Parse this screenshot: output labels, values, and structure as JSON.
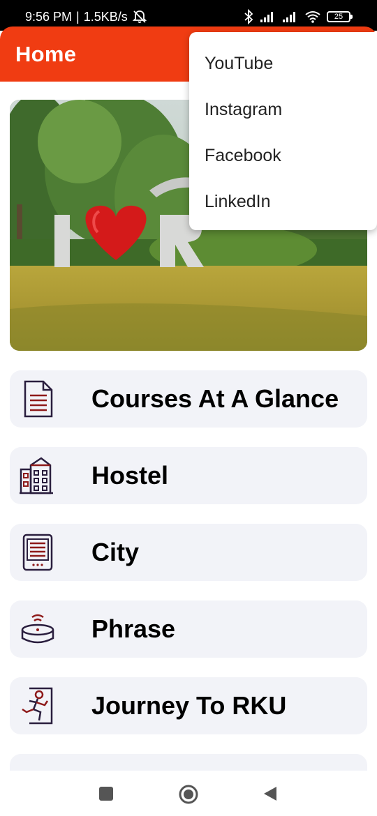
{
  "status_bar": {
    "time": "9:56 PM",
    "separator": "|",
    "speed": "1.5KB/s",
    "battery": "25",
    "icons": [
      "alarm-off-icon",
      "bluetooth-icon",
      "signal-icon",
      "signal-icon",
      "wifi-icon",
      "battery-icon"
    ]
  },
  "app_bar": {
    "title": "Home",
    "color": "#f03c12"
  },
  "hero": {
    "image": "I love RKU sign on lawn"
  },
  "menu": {
    "items": [
      {
        "label": "Courses At A Glance",
        "icon": "document-icon"
      },
      {
        "label": "Hostel",
        "icon": "building-icon"
      },
      {
        "label": "City",
        "icon": "ebook-reader-icon"
      },
      {
        "label": "Phrase",
        "icon": "smart-speaker-icon"
      },
      {
        "label": "Journey To RKU",
        "icon": "runner-icon"
      }
    ]
  },
  "popup_menu": {
    "items": [
      "YouTube",
      "Instagram",
      "Facebook",
      "LinkedIn"
    ]
  },
  "nav": {
    "icons": [
      "recents-square-icon",
      "home-circle-icon",
      "back-triangle-icon"
    ]
  },
  "colors": {
    "accent": "#f03c12",
    "card_bg": "#f2f3f8",
    "icon_dark": "#2a1e3e",
    "icon_red": "#8e1a1a"
  }
}
